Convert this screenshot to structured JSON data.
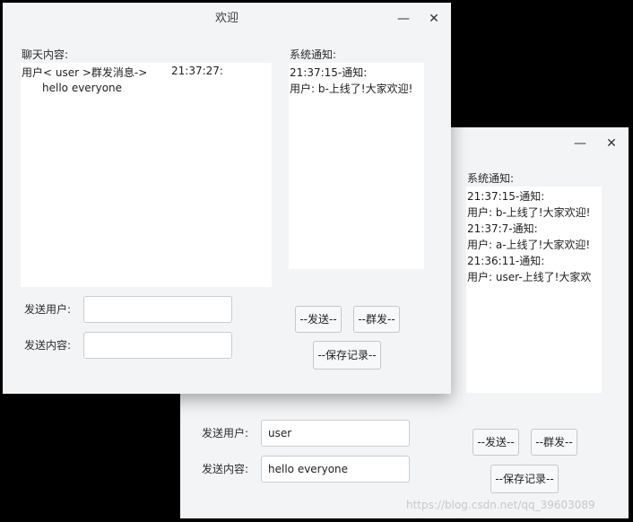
{
  "front": {
    "title": "欢迎",
    "chat_label": "聊天内容:",
    "chat_line1_left": "用户< user >群发消息->",
    "chat_line1_time": "21:37:27:",
    "chat_line2": "hello everyone",
    "notice_label": "系统通知:",
    "notice_lines": [
      "21:37:15-通知:",
      "用户: b-上线了!大家欢迎!"
    ],
    "send_user_label": "发送用户:",
    "send_content_label": "发送内容:",
    "send_user_value": "",
    "send_content_value": "",
    "send_button": "--发送--",
    "broadcast_button": "--群发--",
    "save_button": "--保存记录--"
  },
  "back": {
    "notice_label": "系统通知:",
    "notice_lines": [
      "21:37:15-通知:",
      "用户: b-上线了!大家欢迎!",
      "21:37:7-通知:",
      "用户: a-上线了!大家欢迎!",
      "21:36:11-通知:",
      "用户: user-上线了!大家欢"
    ],
    "send_user_label": "发送用户:",
    "send_content_label": "发送内容:",
    "send_user_value": "user",
    "send_content_value": "hello everyone",
    "send_button": "--发送--",
    "broadcast_button": "--群发--",
    "save_button": "--保存记录--"
  },
  "icons": {
    "minimize": "minimize-icon",
    "close": "close-icon"
  },
  "minimize_glyph": "—",
  "close_glyph": "✕",
  "watermark": "https://blog.csdn.net/qq_39603089"
}
